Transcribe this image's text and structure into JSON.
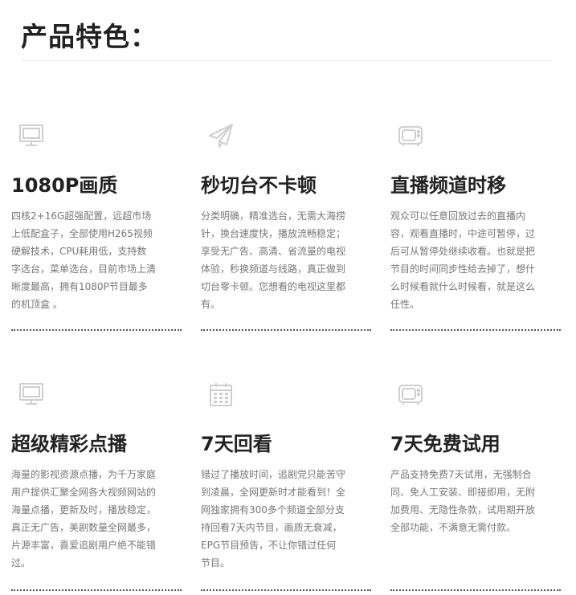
{
  "page": {
    "title": "产品特色："
  },
  "features": [
    {
      "icon": "monitor-icon",
      "title": "1080P画质",
      "description": "四核2+16G超强配置，远超市场上低配盒子，全部使用H265视频硬解技术，CPU耗用低，支持数字选台，菜单选台，目前市场上清晰度最高，拥有1080P节目最多的机顶盒 。"
    },
    {
      "icon": "paper-plane-icon",
      "title": "秒切台不卡顿",
      "description": "分类明确，精准选台，无需大海捞针，换台速度快，播放流畅稳定；享受无广告、高清、省流量的电视体验，秒换频道与线路，真正做到切台零卡顿。您想看的电视这里都有。"
    },
    {
      "icon": "retro-tv-icon",
      "title": "直播频道时移",
      "description": "观众可以任意回放过去的直播内容，观看直播时，中途可暂停，过后可从暂停处继续收看。也就是把节目的时间同步性给去掉了，想什么时候看就什么时候看，就是这么任性。"
    },
    {
      "icon": "monitor-icon",
      "title": "超级精彩点播",
      "description": "海量的影视资源点播，为千万家庭用户提供汇聚全网各大视频网站的海量点播，更新及时，播放稳定，真正无广告，美剧数量全网最多，片源丰富，喜爱追剧用户绝不能错过。"
    },
    {
      "icon": "calendar-icon",
      "title": "7天回看",
      "description": "错过了播放时间，追剧党只能苦守到凌晨，全网更新时才能看到！全网独家拥有300多个频道全部分支持回看7天内节目，画质无衰减，EPG节目预告，不让你错过任何节目。"
    },
    {
      "icon": "retro-tv-icon",
      "title": "7天免费试用",
      "description": "产品支持免费7天试用，无强制合同、免人工安装、即接即用，无附加费用、无隐性条款，试用期开放全部功能，不满意无需付款。"
    }
  ]
}
